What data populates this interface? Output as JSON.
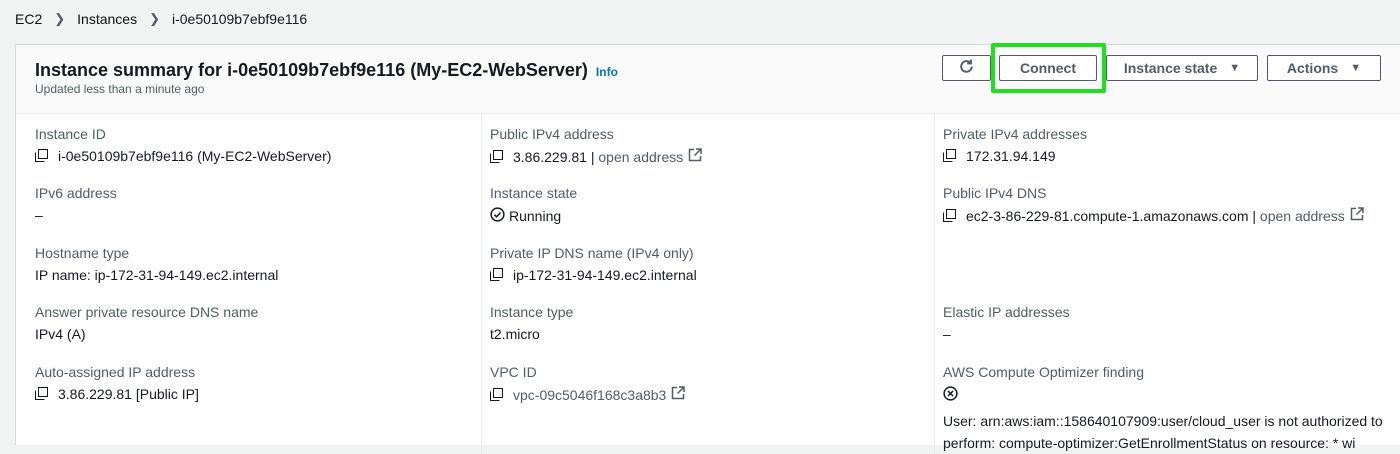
{
  "breadcrumb": {
    "ec2": "EC2",
    "instances": "Instances",
    "current": "i-0e50109b7ebf9e116"
  },
  "header": {
    "title": "Instance summary for i-0e50109b7ebf9e116 (My-EC2-WebServer)",
    "info": "Info",
    "updated": "Updated less than a minute ago",
    "connect": "Connect",
    "instance_state": "Instance state",
    "actions": "Actions",
    "highlight_color": "#1ee01e"
  },
  "col1": {
    "instance_id_label": "Instance ID",
    "instance_id_value": "i-0e50109b7ebf9e116 (My-EC2-WebServer)",
    "ipv6_label": "IPv6 address",
    "ipv6_value": "–",
    "hostname_label": "Hostname type",
    "hostname_value": "IP name: ip-172-31-94-149.ec2.internal",
    "answer_dns_label": "Answer private resource DNS name",
    "answer_dns_value": "IPv4 (A)",
    "auto_ip_label": "Auto-assigned IP address",
    "auto_ip_value": "3.86.229.81 [Public IP]"
  },
  "col2": {
    "public_ipv4_label": "Public IPv4 address",
    "public_ipv4_value": "3.86.229.81",
    "open_address": "open address",
    "state_label": "Instance state",
    "state_value": "Running",
    "private_dns_label": "Private IP DNS name (IPv4 only)",
    "private_dns_value": "ip-172-31-94-149.ec2.internal",
    "type_label": "Instance type",
    "type_value": "t2.micro",
    "vpc_label": "VPC ID",
    "vpc_value": "vpc-09c5046f168c3a8b3"
  },
  "col3": {
    "private_ipv4_label": "Private IPv4 addresses",
    "private_ipv4_value": "172.31.94.149",
    "public_dns_label": "Public IPv4 DNS",
    "public_dns_value": "ec2-3-86-229-81.compute-1.amazonaws.com",
    "open_address": "open address",
    "elastic_label": "Elastic IP addresses",
    "elastic_value": "–",
    "optimizer_label": "AWS Compute Optimizer finding",
    "optimizer_error": "User: arn:aws:iam::158640107909:user/cloud_user is not authorized to perform: compute-optimizer:GetEnrollmentStatus on resource: * wi"
  }
}
